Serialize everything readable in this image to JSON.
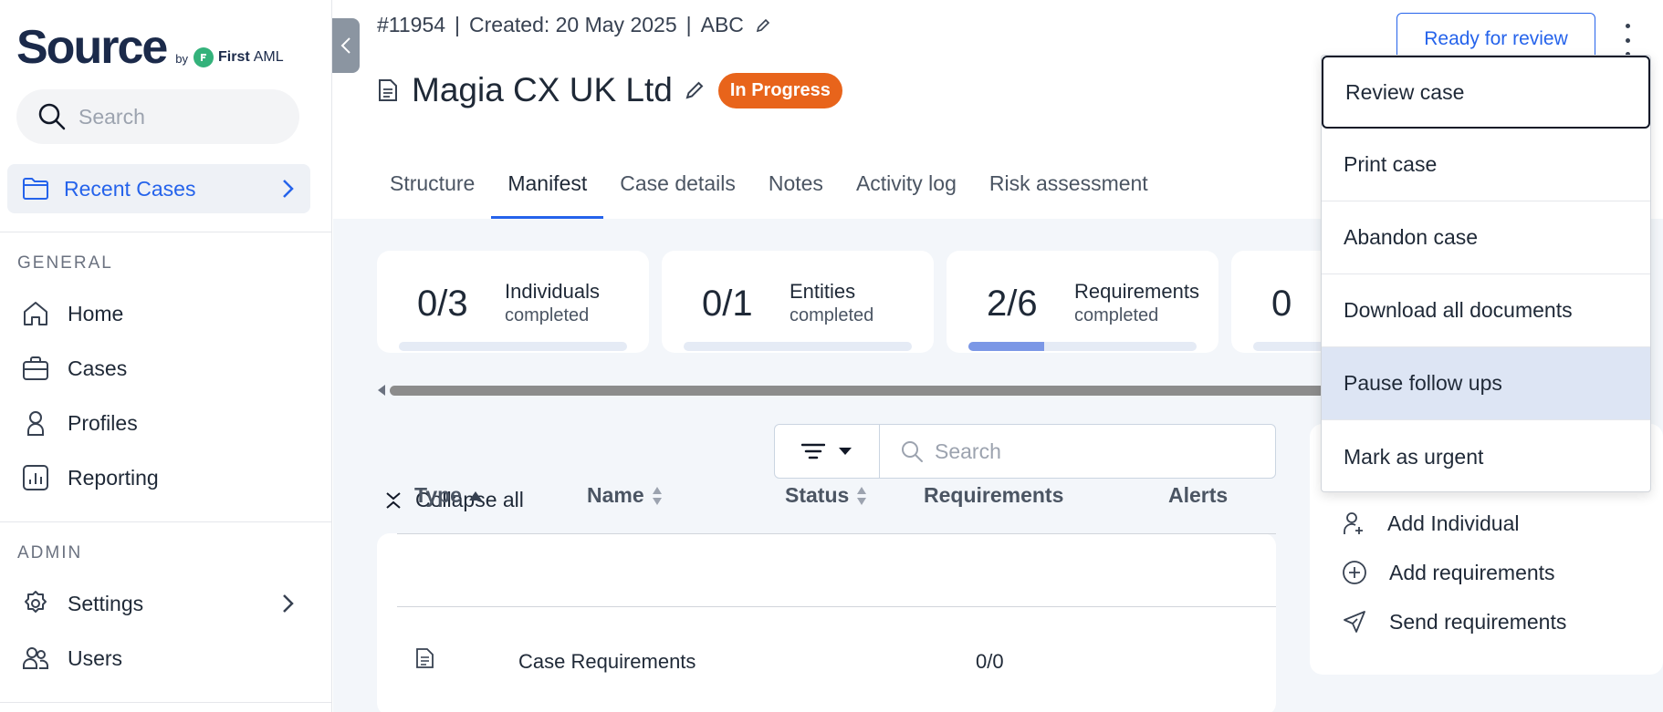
{
  "brand": {
    "name": "Source",
    "by": "by",
    "partner": "First",
    "partner_suffix": "AML"
  },
  "sidebar": {
    "search_placeholder": "Search",
    "recent_cases": "Recent Cases",
    "general_label": "GENERAL",
    "general_items": [
      "Home",
      "Cases",
      "Profiles",
      "Reporting"
    ],
    "admin_label": "ADMIN",
    "admin_items": [
      "Settings",
      "Users"
    ]
  },
  "header": {
    "case_id": "#11954",
    "created": "Created: 20 May 2025",
    "tag": "ABC",
    "title": "Magia CX UK Ltd",
    "status": "In Progress",
    "ready_button": "Ready for review"
  },
  "tabs": [
    "Structure",
    "Manifest",
    "Case details",
    "Notes",
    "Activity log",
    "Risk assessment"
  ],
  "active_tab": "Manifest",
  "stats": [
    {
      "value": "0/3",
      "label": "Individuals",
      "sub": "completed",
      "progress": 0
    },
    {
      "value": "0/1",
      "label": "Entities",
      "sub": "completed",
      "progress": 0
    },
    {
      "value": "2/6",
      "label": "Requirements",
      "sub": "completed",
      "progress": 0.333
    },
    {
      "value": "0",
      "label": "",
      "sub": "",
      "progress": 0
    }
  ],
  "toolbar": {
    "search_placeholder": "Search",
    "collapse_all": "Collapse all"
  },
  "table": {
    "headers": [
      "Type",
      "Name",
      "Status",
      "Requirements",
      "Alerts"
    ],
    "rows": [
      {
        "name": "Case Requirements",
        "requirements": "0/0"
      }
    ]
  },
  "actions": [
    "Add Individual",
    "Add requirements",
    "Send requirements"
  ],
  "menu": {
    "items": [
      "Review case",
      "Print case",
      "Abandon case",
      "Download all documents",
      "Pause follow ups",
      "Mark as urgent"
    ],
    "focused": "Review case",
    "hovered": "Pause follow ups"
  },
  "colors": {
    "accent": "#2563eb",
    "status_in_progress": "#e8641b",
    "brand_navy": "#1b2a4a",
    "brand_green": "#34b27b"
  }
}
